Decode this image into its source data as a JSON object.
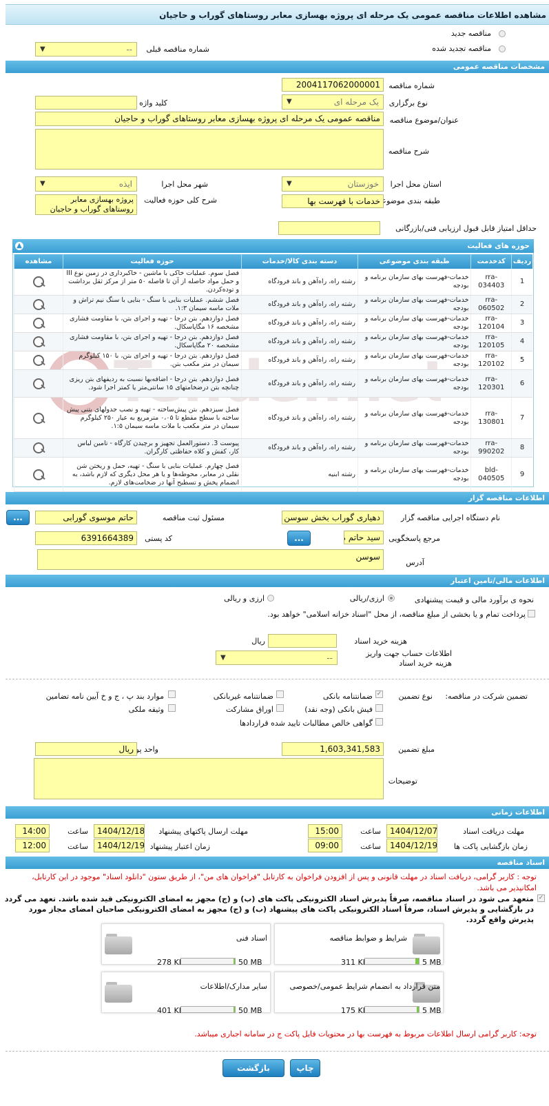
{
  "title": "مشاهده اطلاعات مناقصه عمومی یک مرحله ای پروژه بهسازی معابر روستاهای گوراب و حاجیان",
  "radios": {
    "new": "مناقصه جدید",
    "renew": "مناقصه تجدید شده",
    "prev_label": "شماره مناقصه قبلی",
    "prev_value": "--"
  },
  "sections": {
    "general": "مشخصات مناقصه عمومی",
    "activity": "حوزه های فعالیت",
    "organizer": "اطلاعات مناقصه گزار",
    "finance": "اطلاعات مالی/تامین اعتبار",
    "time": "اطلاعات زمانی",
    "docs": "اسناد مناقصه"
  },
  "general": {
    "number_label": "شماره مناقصه",
    "number": "2004117062000001",
    "type_label": "نوع برگزاری",
    "type": "یک مرحله ای",
    "keyword_label": "کلید واژه",
    "subject_label": "عنوان/موضوع مناقصه",
    "subject": "مناقصه عمومی یک مرحله ای پروژه بهسازی معابر روستاهای گوراب و حاجیان",
    "desc_label": "شرح مناقصه",
    "province_label": "استان محل اجرا",
    "province": "خوزستان",
    "city_label": "شهر محل اجرا",
    "city": "ایذه",
    "category_label": "طبقه بندی موضوعی",
    "category": "خدمات با فهرست بها",
    "scope_label": "شرح کلی حوزه فعالیت",
    "scope": "پروژه بهسازی معابر روستاهای گوراب و حاجیان",
    "min_score_label": "حداقل امتیاز قابل قبول ارزیابی فنی/بازرگانی"
  },
  "table": {
    "headers": [
      "ردیف",
      "کدخدمت",
      "طبقه بندی موضوعی",
      "دسته بندی کالا/خدمات",
      "حوزه فعالیت",
      "مشاهده"
    ],
    "rows": [
      {
        "n": "1",
        "code": "rra-034403",
        "cat": "خدمات-فهرست بهای سازمان برنامه و بودجه",
        "group": "رشته راه، راه‌آهن و باند فرودگاه",
        "act": "فصل سوم. عملیات خاکی با ماشین - خاکبرداری در زمین نوع III و حمل مواد حاصله از آن تا فاصله ۵۰ متر از مرکز ثقل برداشت و توده‌کردن."
      },
      {
        "n": "2",
        "code": "rra-060502",
        "cat": "خدمات-فهرست بهای سازمان برنامه و بودجه",
        "group": "رشته راه، راه‌آهن و باند فرودگاه",
        "act": "فصل ششم. عملیات بنایی با سنگ - بنایی با سنگ نیم تراش و ملات ماسه سیمان ۱:۳."
      },
      {
        "n": "3",
        "code": "rra-120104",
        "cat": "خدمات-فهرست بهای سازمان برنامه و بودجه",
        "group": "رشته راه، راه‌آهن و باند فرودگاه",
        "act": "فصل دوازدهم. بتن درجا - تهیه و اجرای بتن، با مقاومت فشاری مشخصه ۱۶ مگاپاسکال."
      },
      {
        "n": "4",
        "code": "rra-120105",
        "cat": "خدمات-فهرست بهای سازمان برنامه و بودجه",
        "group": "رشته راه، راه‌آهن و باند فرودگاه",
        "act": "فصل دوازدهم. بتن درجا - تهیه و اجرای بتن، با مقاومت فشاری مشخصه ۲۰ مگاپاسکال."
      },
      {
        "n": "5",
        "code": "rra-120102",
        "cat": "خدمات-فهرست بهای سازمان برنامه و بودجه",
        "group": "رشته راه، راه‌آهن و باند فرودگاه",
        "act": "فصل دوازدهم. بتن درجا - تهیه و اجرای بتن، با ۱۵۰ کیلوگرم سیمان در متر مکعب بتن."
      },
      {
        "n": "6",
        "code": "rra-120301",
        "cat": "خدمات-فهرست بهای سازمان برنامه و بودجه",
        "group": "رشته راه، راه‌آهن و باند فرودگاه",
        "act": "فصل دوازدهم. بتن درجا - اضافه‌بها نسبت به ردیفهای بتن ریزی چنانچه بتن درضخامتهای ۱۵ سانتی‌متر یا کمتر اجرا شود."
      },
      {
        "n": "7",
        "code": "rra-130801",
        "cat": "خدمات-فهرست بهای سازمان برنامه و بودجه",
        "group": "رشته راه، راه‌آهن و باند فرودگاه",
        "act": "فصل سیزدهم. بتن پیش‌ساخته - تهیه و نصب جدولهای بتنی پیش ساخته با سطح مقطع تا ۰،۰۵ مترمربع به عیار ۲۵۰ کیلوگرم سیمان در متر مکعب با ملات ماسه سیمان ۱:۵."
      },
      {
        "n": "8",
        "code": "rra-990202",
        "cat": "خدمات-فهرست بهای سازمان برنامه و بودجه",
        "group": "رشته راه، راه‌آهن و باند فرودگاه",
        "act": "پیوست 3. دستورالعمل تجهیز و برچیدن کارگاه - تامین لباس کار، کفش و کلاه حفاظتی کارگران."
      },
      {
        "n": "9",
        "code": "bld-040505",
        "cat": "خدمات-فهرست بهای سازمان برنامه و بودجه",
        "group": "رشته ابنیه",
        "act": "فصل چهارم. عملیات بنایی با سنگ - تهیه، حمل و ریختن شن نقلی در معابر، محوطه‌ها و یا هر محل دیگری که لازم باشد، به انضمام پخش و تسطیح آنها در ضخامت‌های لازم."
      }
    ]
  },
  "organizer": {
    "org_label": "نام دستگاه اجرایی مناقصه گزار",
    "org": "دهیاری گوراب بخش سوسن",
    "resp_label": "مسئول ثبت مناقصه",
    "resp": "حاتم موسوی گورابی",
    "ref_label": "مرجع پاسخگویی",
    "ref": "سید حاتم موسوی",
    "zip_label": "کد پستی",
    "zip": "6391664389",
    "addr_label": "آدرس",
    "addr": "سوسن",
    "btn": "..."
  },
  "finance": {
    "est_label": "نحوه ی برآورد مالی و قیمت پیشنهادی",
    "rial": "ارزی/ریالی",
    "currency": "ارزی و ریالی",
    "treasury": "پرداخت تمام و یا بخشی از مبلغ مناقصه، از محل \"اسناد خزانه اسلامی\" خواهد بود.",
    "fee_label": "هزینه خرید اسناد",
    "fee_unit": "ریال",
    "account_label": "اطلاعات حساب جهت واریز هزینه خرید اسناد",
    "account": "--"
  },
  "guarantee": {
    "label": "تضمین شرکت در مناقصه:",
    "type_label": "نوع تضمین",
    "opts": [
      "ضمانتنامه بانکی",
      "ضمانتنامه غیربانکی",
      "موارد بند پ ، ج و خ آیین نامه تضامین",
      "فیش بانکی (وجه نقد)",
      "اوراق مشارکت",
      "وثیقه ملکی",
      "گواهی خالص مطالبات تایید شده قراردادها"
    ],
    "amount_label": "مبلغ تضمین",
    "amount": "1,603,341,583",
    "unit_label": "واحد پول",
    "unit": "ریال",
    "notes_label": "توضیحات"
  },
  "time": {
    "doc_recv_label": "مهلت دریافت اسناد",
    "doc_recv_date": "1404/12/07",
    "doc_recv_time": "15:00",
    "send_label": "مهلت ارسال پاکتهای پیشنهاد",
    "send_date": "1404/12/18",
    "send_time": "14:00",
    "open_label": "زمان بازگشایی پاکت ها",
    "open_date": "1404/12/19",
    "open_time": "09:00",
    "valid_label": "زمان اعتبار پیشنهاد",
    "valid_date": "1404/12/19",
    "valid_time": "12:00",
    "time_label": "ساعت"
  },
  "docs": {
    "note": "توجه : کاربر گرامی، دریافت اسناد در مهلت قانونی و پس از افزودن فراخوان به کارتابل \"فراخوان های من\"، از طریق ستون \"دانلود اسناد\" موجود در این کارتابل، امکانپذیر می باشد.",
    "commit": "متعهد می شود در اسناد مناقصه، صرفاً پذیرش اسناد الکترونیکی پاکت های (ب) و (ج) مجهز به امضای الکترونیکی قید شده باشد. تعهد می گردد در بازگشایی و پذیرش اسناد، صرفاً اسناد الکترونیکی پاکت های پیشنهاد (ب) و (ج) مجهز به امضای الکترونیکی صاحبان امضای مجاز مورد پذیرش واقع گردد.",
    "files": [
      {
        "name": "شرایط و ضوابط مناقصه",
        "size": "311 KB",
        "max": "5 MB",
        "fill": 0.06
      },
      {
        "name": "اسناد فنی",
        "size": "278 KB",
        "max": "50 MB",
        "fill": 0.01
      },
      {
        "name": "متن قرارداد به انضمام شرایط عمومی/خصوصی",
        "size": "175 KB",
        "max": "5 MB",
        "fill": 0.04
      },
      {
        "name": "سایر مدارک/اطلاعات",
        "size": "401 KB",
        "max": "50 MB",
        "fill": 0.01
      }
    ],
    "warn": "توجه: کاربر گرامی ارسال اطلاعات مربوط به فهرست بها در محتویات فایل پاکت ج در سامانه اجباری میباشد."
  },
  "buttons": {
    "print": "چاپ",
    "back": "بازگشت"
  },
  "watermark": "Tender.net"
}
